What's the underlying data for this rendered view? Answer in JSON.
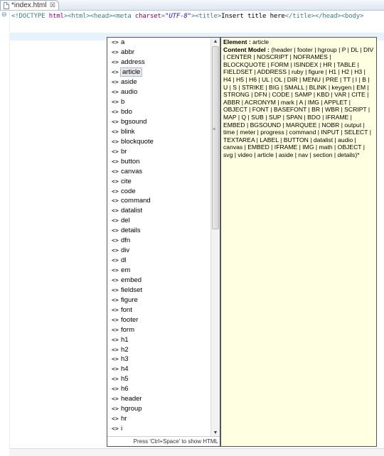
{
  "tab": {
    "title": "*index.html",
    "close": "☒"
  },
  "editor": {
    "line": [
      {
        "c": "<!DOCTYPE ",
        "k": "tag"
      },
      {
        "c": "html",
        "k": "attr"
      },
      {
        "c": "><html><head><meta ",
        "k": "tag"
      },
      {
        "c": "charset",
        "k": "attr"
      },
      {
        "c": "=",
        "k": "tag"
      },
      {
        "c": "\"UTF-8\"",
        "k": "val"
      },
      {
        "c": "><title>",
        "k": "tag"
      },
      {
        "c": "Insert title here",
        "k": "text"
      },
      {
        "c": "</title></head><body>",
        "k": "tag"
      }
    ]
  },
  "proposals": {
    "selected_index": 3,
    "items": [
      "a",
      "abbr",
      "address",
      "article",
      "aside",
      "audio",
      "b",
      "bdo",
      "bgsound",
      "blink",
      "blockquote",
      "br",
      "button",
      "canvas",
      "cite",
      "code",
      "command",
      "datalist",
      "del",
      "details",
      "dfn",
      "div",
      "dl",
      "em",
      "embed",
      "fieldset",
      "figure",
      "font",
      "footer",
      "form",
      "h1",
      "h2",
      "h3",
      "h4",
      "h5",
      "h6",
      "header",
      "hgroup",
      "hr",
      "i"
    ],
    "item_glyph": "<>",
    "status": "Press 'Ctrl+Space' to show HTML"
  },
  "info": {
    "element_label": "Element :",
    "element_value": "article",
    "model_label": "Content Model :",
    "model_value": "(header | footer | hgroup | P | DL | DIV | CENTER | NOSCRIPT | NOFRAMES | BLOCKQUOTE | FORM | ISINDEX | HR | TABLE | FIELDSET | ADDRESS | ruby | figure | H1 | H2 | H3 | H4 | H5 | H6 | UL | OL | DIR | MENU | PRE | TT | I | B | U | S | STRIKE | BIG | SMALL | BLINK | keygen | EM | STRONG | DFN | CODE | SAMP | KBD | VAR | CITE | ABBR | ACRONYM | mark | A | IMG | APPLET | OBJECT | FONT | BASEFONT | BR | WBR | SCRIPT | MAP | Q | SUB | SUP | SPAN | BDO | IFRAME | EMBED | BGSOUND | MARQUEE | NOBR | output | time | meter | progress | command | INPUT | SELECT | TEXTAREA | LABEL | BUTTON | datalist | audio | canvas | EMBED | IFRAME | IMG | math | OBJECT | svg | video | article | aside | nav | section | details)*"
  }
}
